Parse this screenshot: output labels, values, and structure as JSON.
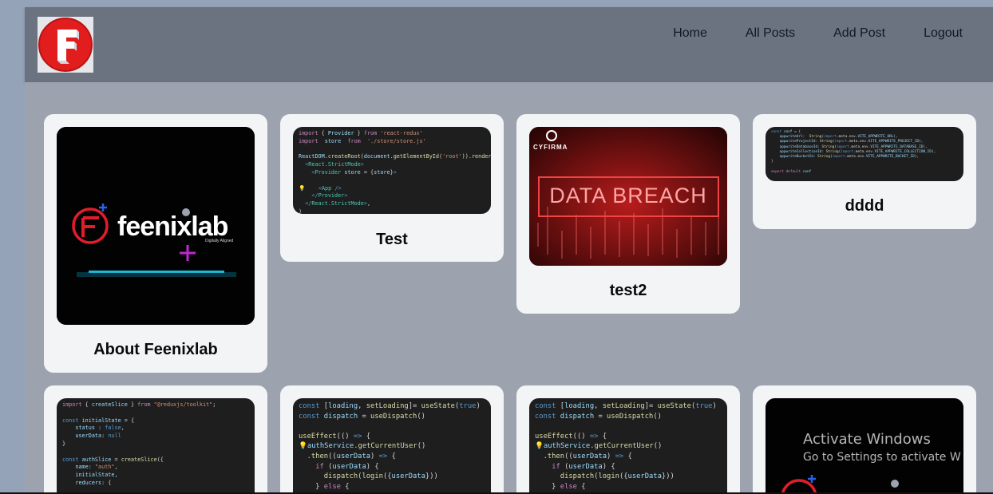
{
  "nav": {
    "items": [
      "Home",
      "All Posts",
      "Add Post",
      "Logout"
    ]
  },
  "posts": [
    {
      "title": "About Feenixlab",
      "image": {
        "brand": "feenixlab",
        "tagline": "Digitally Aligned"
      }
    },
    {
      "title": "Test"
    },
    {
      "title": "test2",
      "image": {
        "brand": "CYFIRMA",
        "headline": "DATA BREACH"
      }
    },
    {
      "title": "dddd"
    }
  ],
  "watermark": {
    "line1": "Activate Windows",
    "line2": "Go to Settings to activate W"
  },
  "colors": {
    "header": "#6b7280",
    "page": "#9ca3af",
    "card": "#f3f4f6",
    "logo_red": "#e11d1d"
  }
}
